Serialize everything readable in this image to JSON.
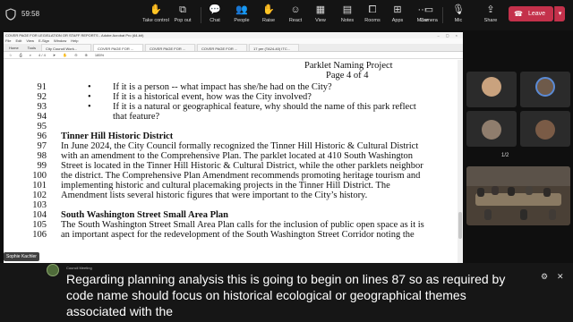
{
  "meeting": {
    "timer": "59:58",
    "toolbar": {
      "take_control": "Take control",
      "pop_out": "Pop out",
      "chat": "Chat",
      "people": "People",
      "people_count": "99",
      "raise": "Raise",
      "react": "React",
      "view": "View",
      "notes": "Notes",
      "rooms": "Rooms",
      "apps": "Apps",
      "more": "More",
      "camera": "Camera",
      "mic": "Mic",
      "share": "Share",
      "leave": "Leave"
    }
  },
  "acrobat": {
    "title": "COVER PAGE FOR LEGISLATION OR STAFF REPORTS - Adobe Acrobat Pro (64-bit)",
    "menu": [
      "File",
      "Edit",
      "View",
      "E-Sign",
      "Window",
      "Help"
    ],
    "tabs": {
      "home": "Home",
      "tools": "Tools",
      "docs": [
        "City Council Work...",
        "COVER PAGE FOR ...",
        "COVER PAGE FOR ...",
        "COVER PAGE FOR ...",
        "17 per (TA24-40) ITC..."
      ]
    },
    "page_indicator": "4 / 4",
    "zoom": "185%"
  },
  "document": {
    "header_title": "Parklet Naming Project",
    "header_page": "Page 4 of 4",
    "lines": [
      {
        "num": "91",
        "bullet": "•",
        "text": "If it is a person -- what impact has she/he had on the City?"
      },
      {
        "num": "92",
        "bullet": "•",
        "text": "If it is a historical event, how was the City involved?"
      },
      {
        "num": "93",
        "bullet": "•",
        "text": "If it is a natural or geographical feature, why should the name of this park reflect"
      },
      {
        "num": "94",
        "bullet": "",
        "text": "that feature?"
      },
      {
        "num": "95",
        "bullet": "",
        "text": ""
      },
      {
        "num": "96",
        "bullet": "",
        "text": "Tinner Hill Historic District"
      },
      {
        "num": "97",
        "bullet": "",
        "text": "In June 2024, the City Council formally recognized the Tinner Hill Historic & Cultural District"
      },
      {
        "num": "98",
        "bullet": "",
        "text": "with an amendment to the Comprehensive Plan. The parklet located at 410 South Washington"
      },
      {
        "num": "99",
        "bullet": "",
        "text": "Street is located in the Tinner Hill Historic & Cultural District, while the other parklets neighbor"
      },
      {
        "num": "100",
        "bullet": "",
        "text": "the district. The Comprehensive Plan Amendment recommends promoting heritage tourism and"
      },
      {
        "num": "101",
        "bullet": "",
        "text": "implementing historic and cultural placemaking projects in the Tinner Hill District. The"
      },
      {
        "num": "102",
        "bullet": "",
        "text": "Amendment lists several historic figures that were important to the City’s history."
      },
      {
        "num": "103",
        "bullet": "",
        "text": ""
      },
      {
        "num": "104",
        "bullet": "",
        "text": "South Washington Street Small Area Plan"
      },
      {
        "num": "105",
        "bullet": "",
        "text": "The South Washington Street Small Area Plan calls for the inclusion of public open space as it is"
      },
      {
        "num": "106",
        "bullet": "",
        "text": "an important aspect for the redevelopment of the South Washington Street Corridor noting the"
      }
    ],
    "presenter_name": "Sophie Kachler"
  },
  "participants": {
    "pager": "1/2"
  },
  "captions": {
    "speaker": "Council Meeting",
    "text": "Regarding planning analysis this is going to begin on lines 87 so as required by code name should focus on historical ecological or geographical themes associated with the"
  },
  "colors": {
    "leave": "#c4314b",
    "caption_bg": "#161616",
    "topbar": "#141414"
  }
}
